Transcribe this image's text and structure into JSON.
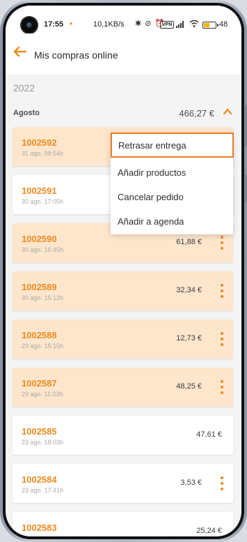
{
  "status_bar": {
    "time": "17:55",
    "dot": "•",
    "speed": "10,1KB/s",
    "icons": "✱ ⊘ ⏰",
    "vpn": "VPN",
    "battery_percent": "48",
    "battery_level": 0.48
  },
  "header": {
    "title": "Mis compras online"
  },
  "year": "2022",
  "month": {
    "label": "Agosto",
    "total": "466,27 €"
  },
  "orders": [
    {
      "id": "1002592",
      "date": "31 ago. 08:54h",
      "amount": "",
      "highlight": true,
      "menu": true
    },
    {
      "id": "1002591",
      "date": "30 ago. 17:05h",
      "amount": "",
      "highlight": false,
      "menu": true
    },
    {
      "id": "1002590",
      "date": "30 ago. 16:45h",
      "amount": "61,88 €",
      "highlight": true,
      "menu": true
    },
    {
      "id": "1002589",
      "date": "30 ago. 15:12h",
      "amount": "32,34 €",
      "highlight": true,
      "menu": true
    },
    {
      "id": "1002588",
      "date": "29 ago. 15:15h",
      "amount": "12,73 €",
      "highlight": true,
      "menu": true
    },
    {
      "id": "1002587",
      "date": "29 ago. 11:23h",
      "amount": "48,25 €",
      "highlight": true,
      "menu": true
    },
    {
      "id": "1002585",
      "date": "23 ago. 18:03h",
      "amount": "47,61 €",
      "highlight": false,
      "menu": false
    },
    {
      "id": "1002584",
      "date": "23 ago. 17:41h",
      "amount": "3,53 €",
      "highlight": false,
      "menu": true
    },
    {
      "id": "1002583",
      "date": "",
      "amount": "25,24 €",
      "highlight": false,
      "menu": false
    }
  ],
  "context_menu": {
    "items": [
      {
        "label": "Retrasar entrega",
        "selected": true
      },
      {
        "label": "Añadir productos",
        "selected": false
      },
      {
        "label": "Cancelar pedido",
        "selected": false
      },
      {
        "label": "Añadir a agenda",
        "selected": false
      }
    ]
  },
  "colors": {
    "accent": "#ef8a1e",
    "highlight_card": "#fde6cc",
    "selection_border": "#e67e22"
  }
}
